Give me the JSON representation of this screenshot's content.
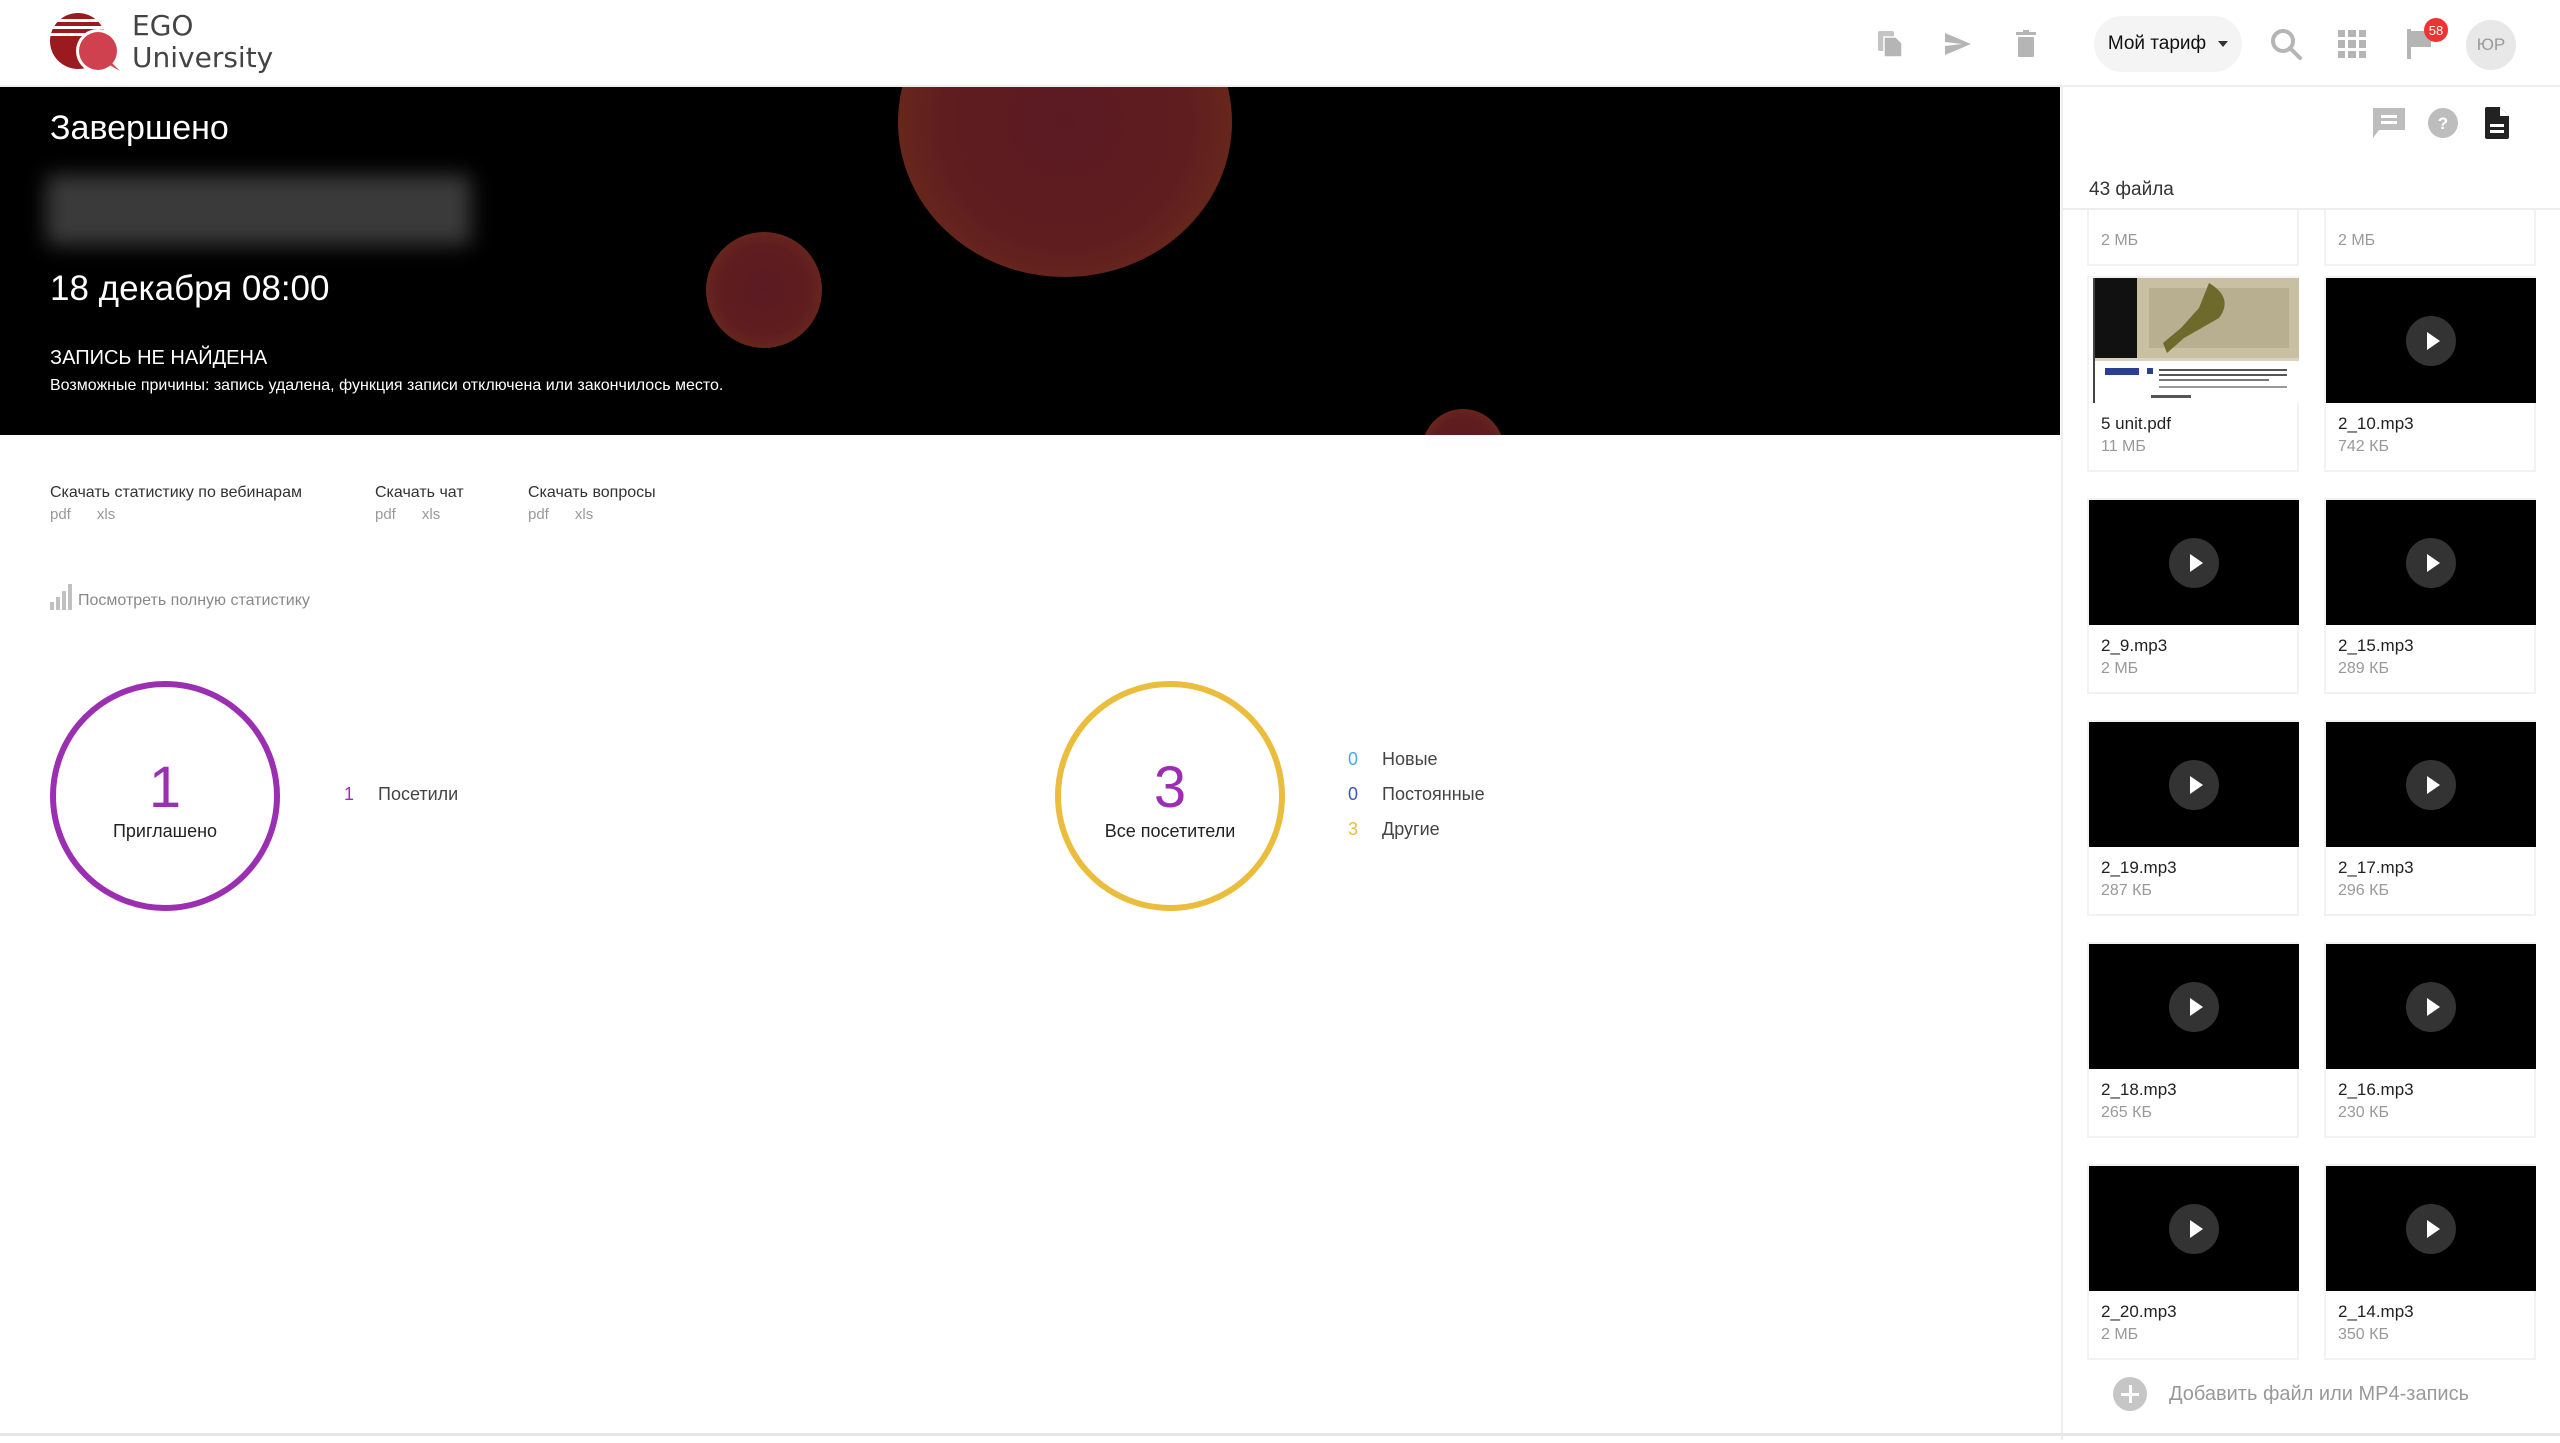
{
  "header": {
    "logo_line1": "EGO",
    "logo_line2": "University",
    "toolbar_icons": [
      "copy-icon",
      "send-icon",
      "trash-icon"
    ],
    "tariff_label": "Мой тариф",
    "notifications_count": "58",
    "avatar_initials": "ЮР",
    "colors": {
      "logo_red": "#d0414f",
      "logo_dark_red": "#9a1a1f",
      "icon_gray": "#b5b5b5",
      "badge": "#e33333"
    }
  },
  "banner": {
    "status": "Завершено",
    "title_blurred": "",
    "date": "18 декабря 08:00",
    "record_not_found": "ЗАПИСЬ НЕ НАЙДЕНА",
    "record_reason": "Возможные причины: запись удалена, функция записи отключена или закончилось место."
  },
  "downloads": [
    {
      "label": "Скачать статистику по вебинарам",
      "formats": [
        "pdf",
        "xls"
      ]
    },
    {
      "label": "Скачать чат",
      "formats": [
        "pdf",
        "xls"
      ]
    },
    {
      "label": "Скачать вопросы",
      "formats": [
        "pdf",
        "xls"
      ]
    }
  ],
  "full_stats_link": "Посмотреть полную статистику",
  "invited": {
    "value": "1",
    "label": "Приглашено",
    "ring_color": "#9b2fb1",
    "legend": [
      {
        "value": "1",
        "label": "Посетили",
        "color": "#9b2fb1"
      }
    ]
  },
  "visitors": {
    "value": "3",
    "label": "Все посетители",
    "ring_color": "#ebbd3d",
    "legend": [
      {
        "value": "0",
        "label": "Новые",
        "color": "#4aa8e8"
      },
      {
        "value": "0",
        "label": "Постоянные",
        "color": "#3a55c8"
      },
      {
        "value": "3",
        "label": "Другие",
        "color": "#ebbd3d"
      }
    ]
  },
  "sidebar": {
    "icons": [
      "chat-icon",
      "help-icon",
      "document-icon"
    ],
    "files_count": "43 файла",
    "files": [
      {
        "name": "",
        "size": "2 МБ",
        "type": "audio"
      },
      {
        "name": "",
        "size": "2 МБ",
        "type": "audio"
      },
      {
        "name": "5 unit.pdf",
        "size": "11 МБ",
        "type": "pdf"
      },
      {
        "name": "2_10.mp3",
        "size": "742 КБ",
        "type": "audio"
      },
      {
        "name": "2_9.mp3",
        "size": "2 МБ",
        "type": "audio"
      },
      {
        "name": "2_15.mp3",
        "size": "289 КБ",
        "type": "audio"
      },
      {
        "name": "2_19.mp3",
        "size": "287 КБ",
        "type": "audio"
      },
      {
        "name": "2_17.mp3",
        "size": "296 КБ",
        "type": "audio"
      },
      {
        "name": "2_18.mp3",
        "size": "265 КБ",
        "type": "audio"
      },
      {
        "name": "2_16.mp3",
        "size": "230 КБ",
        "type": "audio"
      },
      {
        "name": "2_20.mp3",
        "size": "2 МБ",
        "type": "audio"
      },
      {
        "name": "2_14.mp3",
        "size": "350 КБ",
        "type": "audio"
      }
    ],
    "add_file_label": "Добавить файл или MP4-запись"
  }
}
